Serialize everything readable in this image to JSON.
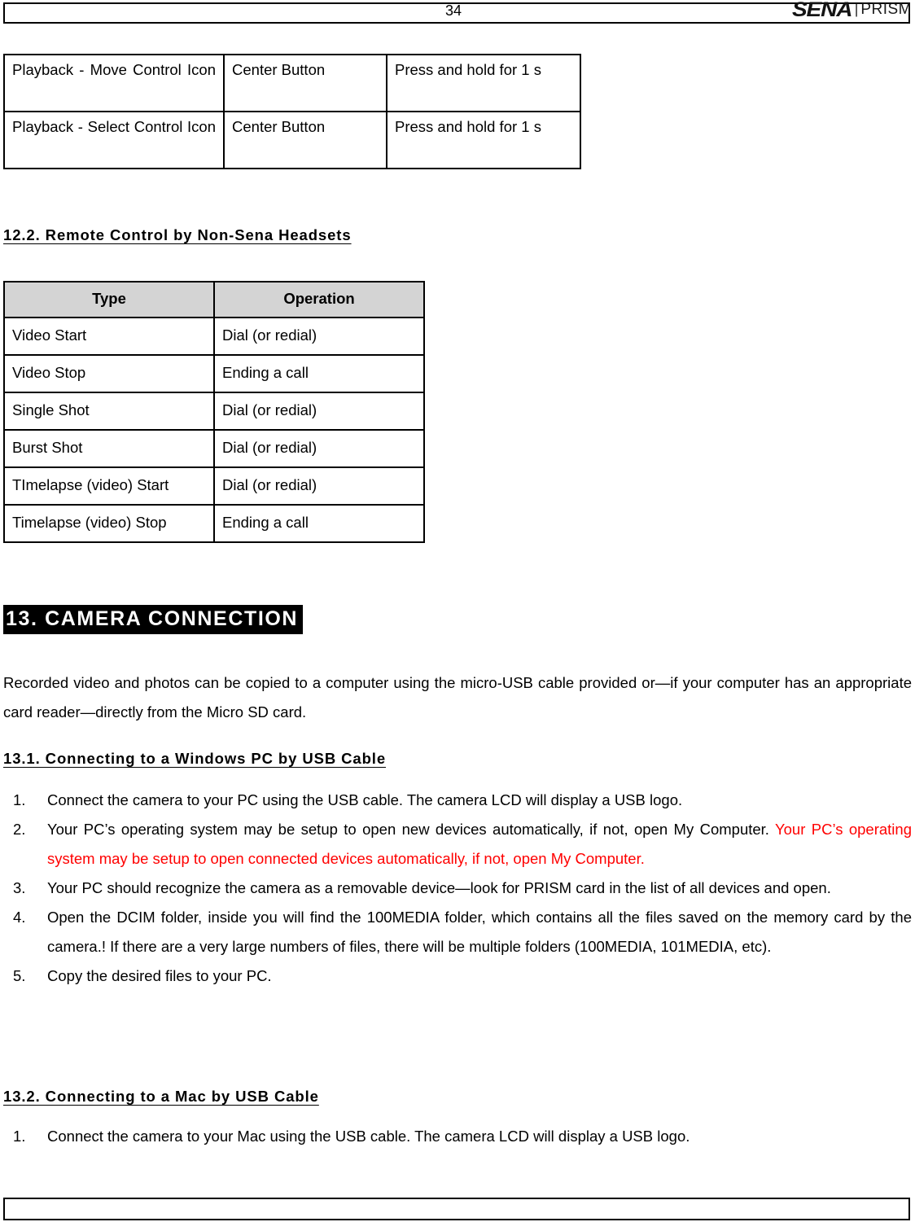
{
  "header": {
    "brand_name": "SENA",
    "brand_separator": "|",
    "brand_product": "PRISM"
  },
  "table_controls": {
    "rows": [
      {
        "type": "Playback - Move Control Icon",
        "button": "Center Button",
        "operation": "Press and hold for 1 s"
      },
      {
        "type": "Playback - Select Control Icon",
        "button": "Center Button",
        "operation": "Press and hold for 1 s"
      }
    ]
  },
  "heading_12_2": "12.2. Remote Control by Non-Sena Headsets",
  "table_remote": {
    "headers": [
      "Type",
      "Operation"
    ],
    "rows": [
      [
        "Video Start",
        "Dial (or redial)"
      ],
      [
        "Video Stop",
        "Ending a call"
      ],
      [
        "Single Shot",
        "Dial (or redial)"
      ],
      [
        "Burst Shot",
        "Dial (or redial)"
      ],
      [
        "TImelapse (video) Start",
        "Dial (or redial)"
      ],
      [
        "Timelapse (video) Stop",
        "Ending a call"
      ]
    ]
  },
  "heading_13": "13. CAMERA CONNECTION",
  "intro_paragraph": "Recorded video and photos can be copied to a computer using the micro-USB cable provided or—if your computer has an appropriate card reader—directly from the Micro SD card.",
  "heading_13_1": "13.1. Connecting to a Windows PC by USB Cable",
  "windows_steps": {
    "numbers": [
      "1.",
      "2.",
      "3.",
      "4.",
      "5."
    ],
    "step1": "Connect the camera to your PC using the USB cable. The camera LCD will display a USB logo.",
    "step2_black": "Your PC’s operating system may be setup to open new devices automatically, if not, open My Computer. ",
    "step2_red": "Your PC’s operating system may be setup to open connected devices automatically, if not, open My Computer.",
    "step3": "Your PC should recognize the camera as a removable device—look for PRISM card in the list of all devices and open.",
    "step4": "Open the DCIM folder, inside you will find the 100MEDIA folder, which contains all the files saved on the memory card by the camera.! If there are a very large numbers of files, there will be multiple folders (100MEDIA, 101MEDIA, etc).",
    "step5": "Copy the desired files to your PC."
  },
  "heading_13_2": "13.2. Connecting to a Mac by USB Cable",
  "mac_steps": {
    "numbers": [
      "1."
    ],
    "step1": "Connect the camera to your Mac using the USB cable. The camera LCD will display a USB logo."
  },
  "footer": {
    "page_number": "34"
  },
  "colors": {
    "highlight_red": "#ff0000",
    "table_header_gray": "#d4d4d4",
    "banner_background": "#000000"
  }
}
